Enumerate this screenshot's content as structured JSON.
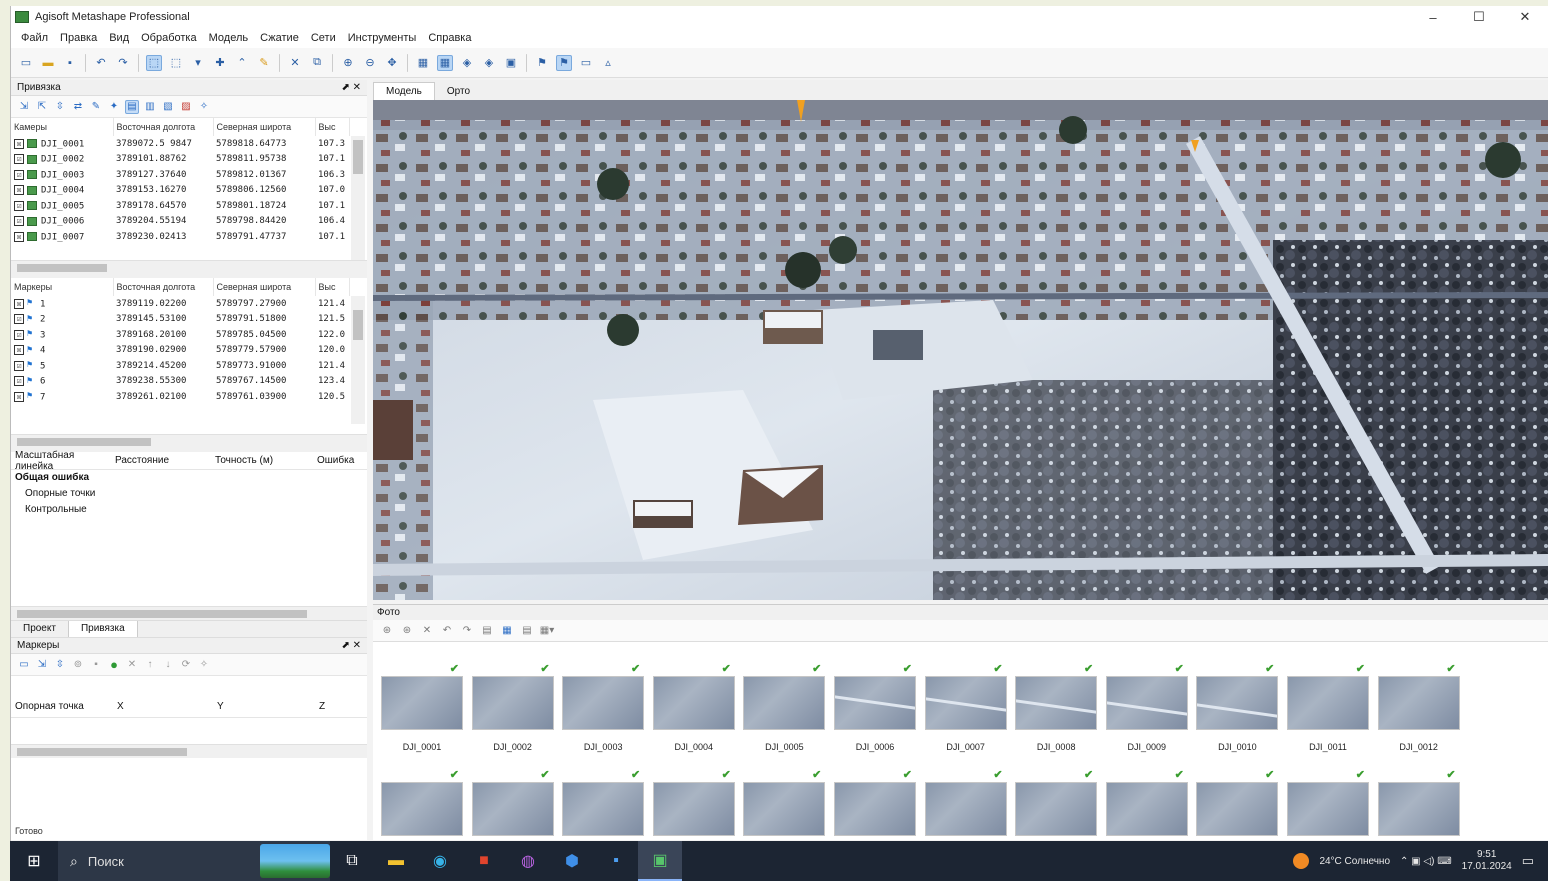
{
  "window": {
    "title": "Agisoft Metashape Professional",
    "controls": [
      "–",
      "☐",
      "✕"
    ]
  },
  "menu": [
    "Файл",
    "Правка",
    "Вид",
    "Обработка",
    "Модель",
    "Сжатие",
    "Сети",
    "Инструменты",
    "Справка"
  ],
  "left_panel": {
    "title": "Привязка",
    "cameras_headers": [
      "Камеры",
      "Восточная долгота",
      "Северная широта",
      "Выс"
    ],
    "cameras": [
      {
        "name": "DJI_0001",
        "east": "3789072.5 9847",
        "north": "5789818.64773",
        "alt": "107.3",
        "check": "☒"
      },
      {
        "name": "DJI_0002",
        "east": "3789101.88762",
        "north": "5789811.95738",
        "alt": "107.1",
        "check": "☑"
      },
      {
        "name": "DJI_0003",
        "east": "3789127.37640",
        "north": "5789812.01367",
        "alt": "106.3",
        "check": "☑"
      },
      {
        "name": "DJI_0004",
        "east": "3789153.16270",
        "north": "5789806.12560",
        "alt": "107.0",
        "check": "☒"
      },
      {
        "name": "DJI_0005",
        "east": "3789178.64570",
        "north": "5789801.18724",
        "alt": "107.1",
        "check": "☑"
      },
      {
        "name": "DJI_0006",
        "east": "3789204.55194",
        "north": "5789798.84420",
        "alt": "106.4",
        "check": "☑"
      },
      {
        "name": "DJI_0007",
        "east": "3789230.02413",
        "north": "5789791.47737",
        "alt": "107.1",
        "check": "☒"
      }
    ],
    "markers_headers": [
      "Маркеры",
      "Восточная долгота",
      "Северная широта",
      "Выс"
    ],
    "markers": [
      {
        "name": "1",
        "east": "3789119.02200",
        "north": "5789797.27900",
        "alt": "121.4",
        "check": "☒"
      },
      {
        "name": "2",
        "east": "3789145.53100",
        "north": "5789791.51800",
        "alt": "121.5",
        "check": "☑"
      },
      {
        "name": "3",
        "east": "3789168.20100",
        "north": "5789785.04500",
        "alt": "122.0",
        "check": "☑"
      },
      {
        "name": "4",
        "east": "3789190.02900",
        "north": "5789779.57900",
        "alt": "120.0",
        "check": "☒"
      },
      {
        "name": "5",
        "east": "3789214.45200",
        "north": "5789773.91000",
        "alt": "121.4",
        "check": "☑"
      },
      {
        "name": "6",
        "east": "3789238.55300",
        "north": "5789767.14500",
        "alt": "123.4",
        "check": "☑"
      },
      {
        "name": "7",
        "east": "3789261.02100",
        "north": "5789761.03900",
        "alt": "120.5",
        "check": "☒"
      }
    ],
    "error_headers": [
      "Масштабная линейка",
      "Расстояние",
      "Точность (м)",
      "Ошибка"
    ],
    "error_title": "Общая ошибка",
    "error_lines": [
      "Опорные точки",
      "Контрольные"
    ],
    "tabs": [
      "Проект",
      "Привязка"
    ],
    "sub_title": "Маркеры",
    "coord_headers": [
      "Опорная точка",
      "X",
      "Y",
      "Z"
    ]
  },
  "view_tabs": [
    "Модель",
    "Орто"
  ],
  "photos": {
    "title": "Фото",
    "row1": [
      "DJI_0001",
      "DJI_0002",
      "DJI_0003",
      "DJI_0004",
      "DJI_0005",
      "DJI_0006",
      "DJI_0007",
      "DJI_0008",
      "DJI_0009",
      "DJI_0010",
      "DJI_0011",
      "DJI_0012"
    ],
    "row2_count": 12
  },
  "status_left": "Готово",
  "taskbar": {
    "search_text": "Поиск",
    "weather": "24°C Солнечно",
    "time": "9:51",
    "date": "17.01.2024"
  }
}
